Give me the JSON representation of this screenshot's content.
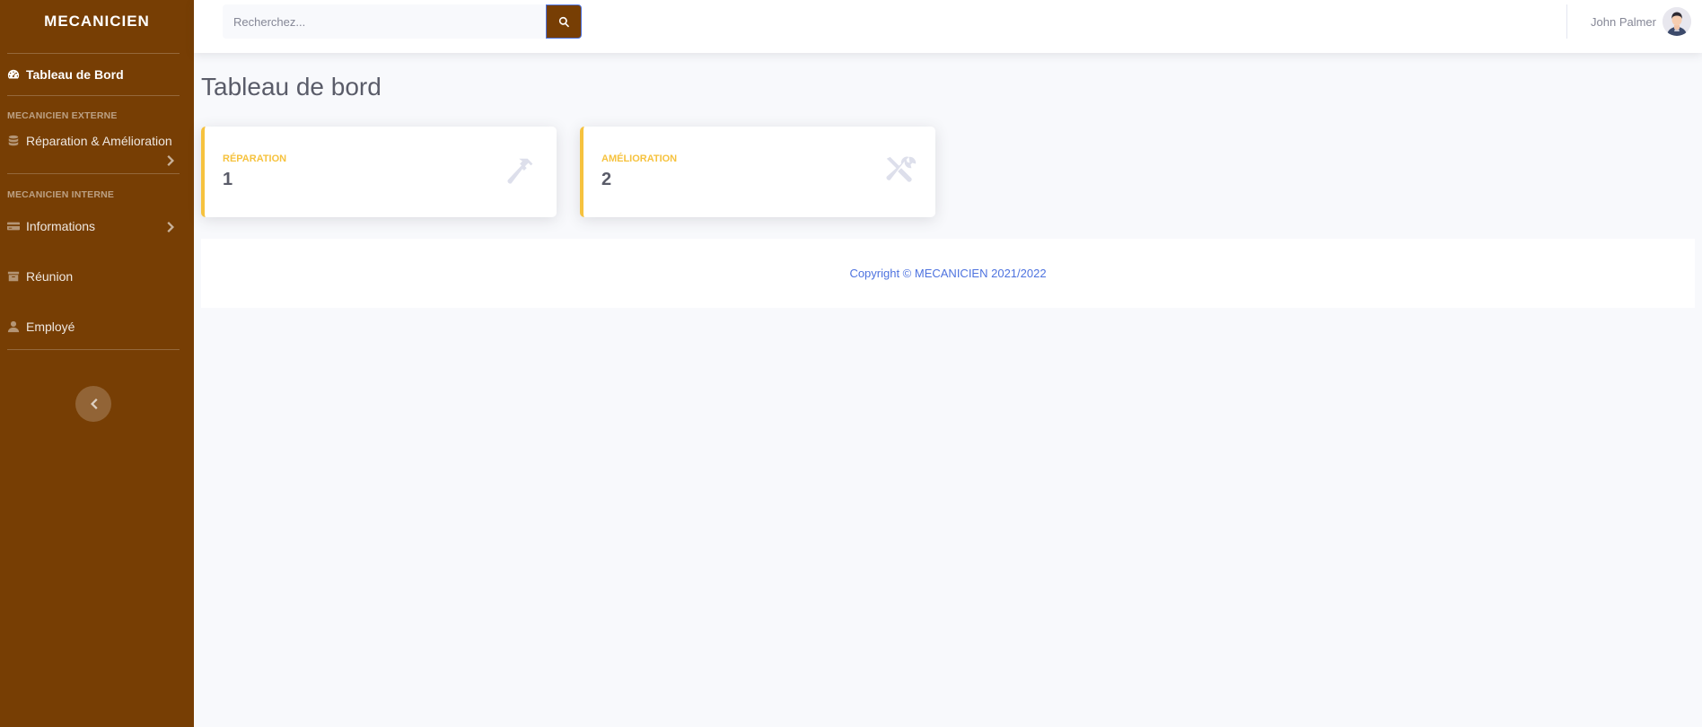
{
  "sidebar": {
    "brand": "MECANICIEN",
    "dashboard_label": "Tableau de Bord",
    "heading_externe": "MECANICIEN EXTERNE",
    "item_reparation": "Réparation & Amélioration",
    "heading_interne": "MECANICIEN INTERNE",
    "item_informations": "Informations",
    "item_reunion": "Réunion",
    "item_employe": "Employé"
  },
  "topbar": {
    "search_placeholder": "Recherchez...",
    "user_name": "John Palmer"
  },
  "main": {
    "title": "Tableau de bord",
    "cards": [
      {
        "label": "Réparation",
        "value": "1",
        "icon": "hammer-icon"
      },
      {
        "label": "Amélioration",
        "value": "2",
        "icon": "tools-icon"
      }
    ]
  },
  "footer": {
    "copyright": "Copyright © MECANICIEN 2021/2022"
  },
  "colors": {
    "sidebar_bg": "#773e04",
    "card_accent": "#f6c23e",
    "link_blue": "#4e73df"
  }
}
